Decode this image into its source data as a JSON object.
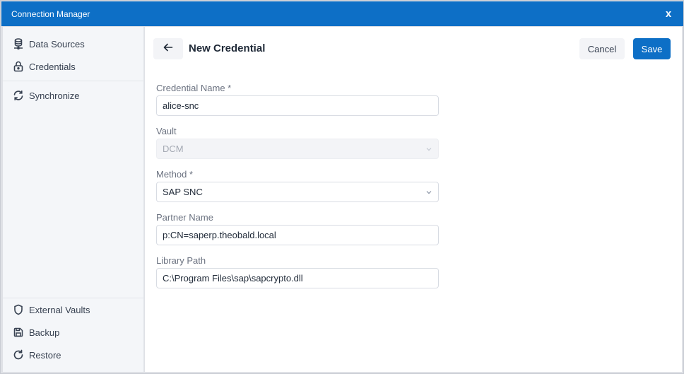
{
  "window": {
    "title": "Connection Manager",
    "close_label": "x"
  },
  "sidebar": {
    "top_items": [
      {
        "label": "Data Sources",
        "icon": "database-icon"
      },
      {
        "label": "Credentials",
        "icon": "lock-icon"
      }
    ],
    "middle_items": [
      {
        "label": "Synchronize",
        "icon": "sync-icon"
      }
    ],
    "bottom_items": [
      {
        "label": "External Vaults",
        "icon": "shield-icon"
      },
      {
        "label": "Backup",
        "icon": "save-disk-icon"
      },
      {
        "label": "Restore",
        "icon": "restore-icon"
      }
    ]
  },
  "header": {
    "title": "New Credential",
    "cancel_label": "Cancel",
    "save_label": "Save"
  },
  "form": {
    "credential_name": {
      "label": "Credential Name *",
      "value": "alice-snc"
    },
    "vault": {
      "label": "Vault",
      "value": "DCM",
      "disabled": true
    },
    "method": {
      "label": "Method *",
      "value": "SAP SNC"
    },
    "partner_name": {
      "label": "Partner Name",
      "value": "p:CN=saperp.theobald.local"
    },
    "library_path": {
      "label": "Library Path",
      "value": "C:\\Program Files\\sap\\sapcrypto.dll"
    }
  },
  "colors": {
    "accent": "#0d6fc6",
    "sidebar_bg": "#f4f6f9"
  }
}
